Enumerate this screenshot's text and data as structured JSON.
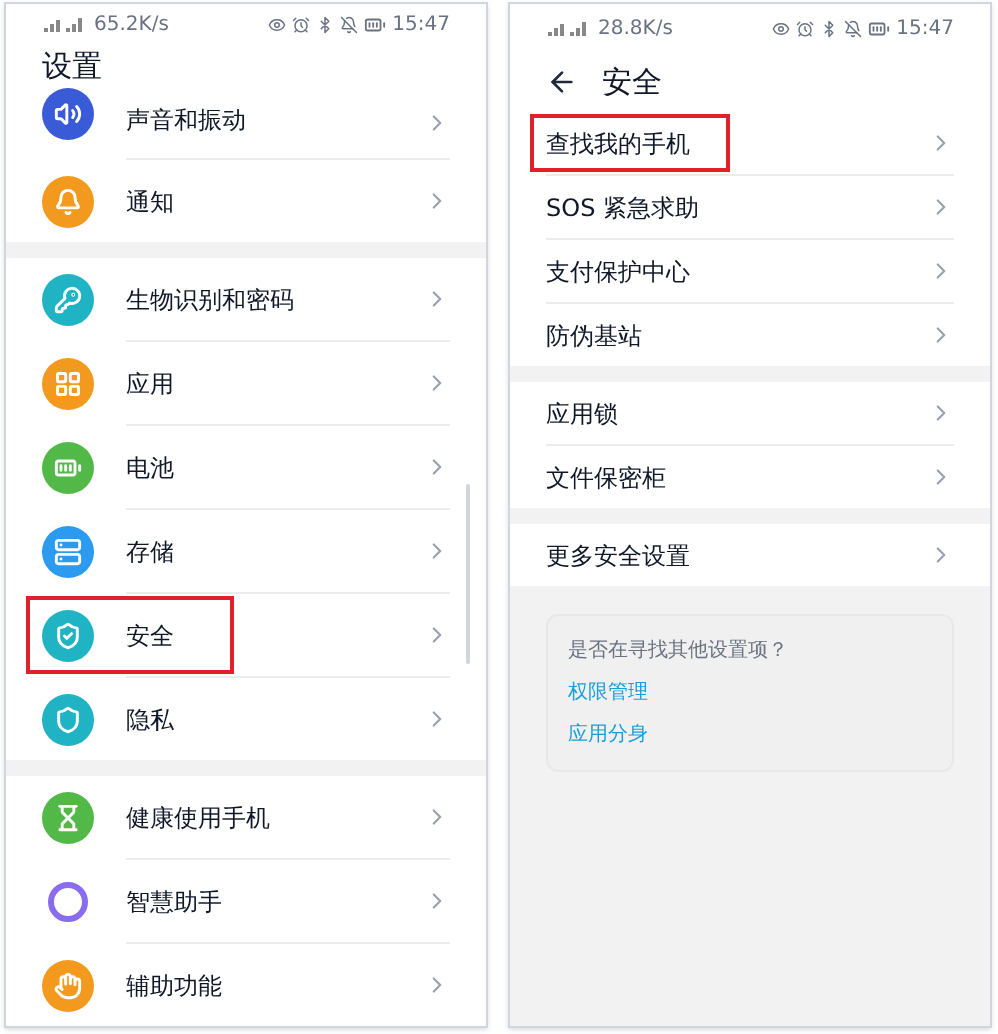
{
  "panels": [
    {
      "status_bar": {
        "speed": "65.2K/s",
        "time": "15:47"
      },
      "header": {
        "title": "设置",
        "back": false
      },
      "groups": [
        {
          "items": [
            {
              "label": "声音和振动",
              "color": "#3a5bd8",
              "highlighted": false
            },
            {
              "label": "通知",
              "color": "#f39a1e",
              "highlighted": false
            }
          ]
        },
        {
          "items": [
            {
              "label": "生物识别和密码",
              "color": "#20b3c4",
              "highlighted": false
            },
            {
              "label": "应用",
              "color": "#f39a1e",
              "highlighted": false
            },
            {
              "label": "电池",
              "color": "#52b948",
              "highlighted": false
            },
            {
              "label": "存储",
              "color": "#2a9bee",
              "highlighted": false
            },
            {
              "label": "安全",
              "color": "#20b3c4",
              "highlighted": true
            },
            {
              "label": "隐私",
              "color": "#20b3c4",
              "highlighted": false
            }
          ]
        },
        {
          "items": [
            {
              "label": "健康使用手机",
              "color": "#52b948",
              "highlighted": false
            },
            {
              "label": "智慧助手",
              "color": "#8a6cf0",
              "highlighted": false
            },
            {
              "label": "辅助功能",
              "color": "#f39a1e",
              "highlighted": false
            }
          ]
        }
      ]
    },
    {
      "status_bar": {
        "speed": "28.8K/s",
        "time": "15:47"
      },
      "header": {
        "title": "安全",
        "back": true
      },
      "groups": [
        {
          "items": [
            {
              "label": "查找我的手机",
              "highlighted": true
            },
            {
              "label": "SOS 紧急求助",
              "highlighted": false
            },
            {
              "label": "支付保护中心",
              "highlighted": false
            },
            {
              "label": "防伪基站",
              "highlighted": false
            }
          ]
        },
        {
          "items": [
            {
              "label": "应用锁",
              "highlighted": false
            },
            {
              "label": "文件保密柜",
              "highlighted": false
            }
          ]
        },
        {
          "items": [
            {
              "label": "更多安全设置",
              "highlighted": false
            }
          ]
        }
      ],
      "hint_card": {
        "question": "是否在寻找其他设置项？",
        "links": [
          "权限管理",
          "应用分身"
        ]
      }
    }
  ]
}
